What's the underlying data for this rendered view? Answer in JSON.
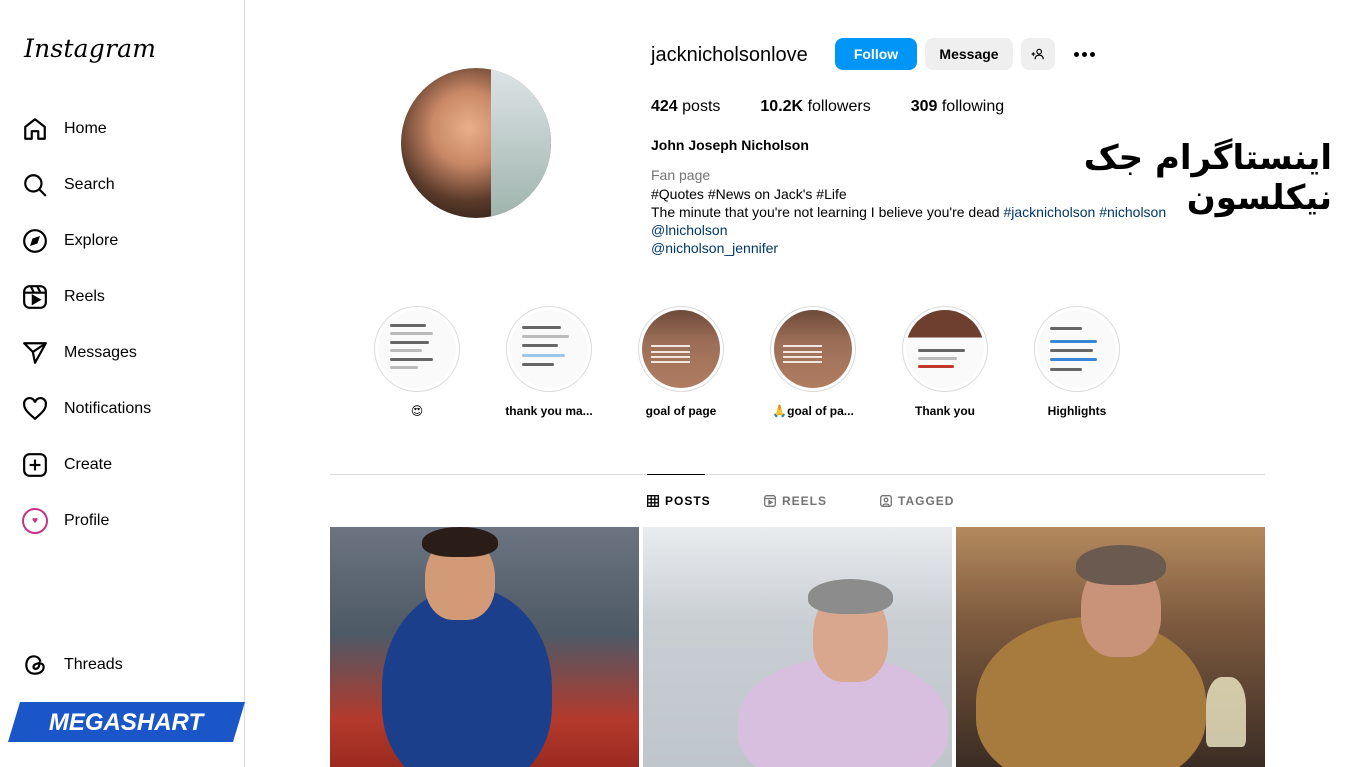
{
  "app": {
    "logo": "Instagram"
  },
  "sidebar": {
    "items": [
      {
        "label": "Home",
        "icon": "home-icon"
      },
      {
        "label": "Search",
        "icon": "search-icon"
      },
      {
        "label": "Explore",
        "icon": "compass-icon"
      },
      {
        "label": "Reels",
        "icon": "reels-icon"
      },
      {
        "label": "Messages",
        "icon": "send-icon"
      },
      {
        "label": "Notifications",
        "icon": "heart-icon"
      },
      {
        "label": "Create",
        "icon": "plus-square-icon"
      },
      {
        "label": "Profile",
        "icon": "avatar-icon"
      },
      {
        "label": "Threads",
        "icon": "threads-icon"
      }
    ]
  },
  "watermark": {
    "text": "MEGASHART",
    "color": "#1a56c8"
  },
  "profile": {
    "username": "jacknicholsonlove",
    "follow_label": "Follow",
    "message_label": "Message",
    "stats": [
      {
        "count": "424",
        "label": "posts"
      },
      {
        "count": "10.2K",
        "label": "followers"
      },
      {
        "count": "309",
        "label": "following"
      }
    ],
    "full_name": "John Joseph Nicholson",
    "category": "Fan page",
    "bio_line1": "#Quotes #News on Jack's #Life",
    "bio_line2_text": "The minute that you're not learning I believe you're dead ",
    "bio_line2_tags": "#jacknicholson #nicholson",
    "bio_mention1": "@lnicholson",
    "bio_mention2": "@nicholson_jennifer"
  },
  "overlay_title": "اینستاگرام جک نیکلسون",
  "highlights": [
    {
      "label": "😍"
    },
    {
      "label": "thank you ma..."
    },
    {
      "label": "goal of page"
    },
    {
      "label": "🙏goal of pa..."
    },
    {
      "label": "Thank you"
    },
    {
      "label": "Highlights"
    }
  ],
  "tabs": [
    {
      "label": "POSTS",
      "active": true
    },
    {
      "label": "REELS",
      "active": false
    },
    {
      "label": "TAGGED",
      "active": false
    }
  ],
  "colors": {
    "accent": "#0095f6",
    "link": "#00376b",
    "muted": "#737373"
  }
}
